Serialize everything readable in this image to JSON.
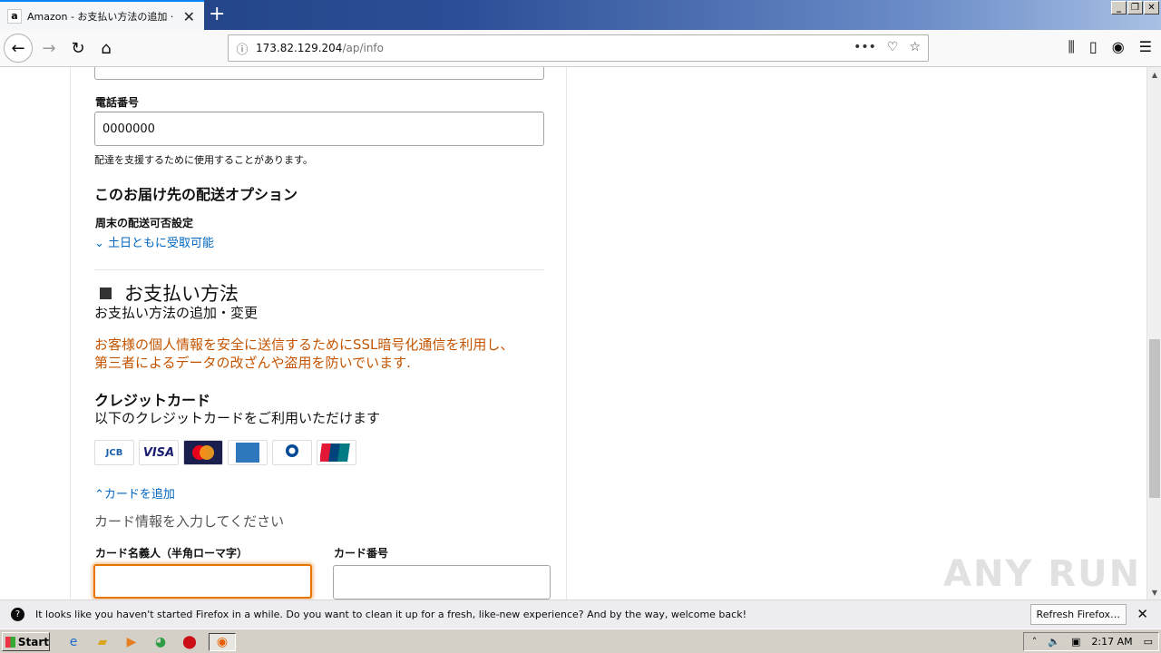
{
  "browser": {
    "tab_title": "Amazon - お支払い方法の追加 · S",
    "tab_favicon": "a",
    "url_host": "173.82.129.204",
    "url_path": "/ap/info",
    "new_tab": "+",
    "icons": {
      "back": "back-arrow-icon",
      "forward": "forward-arrow-icon",
      "reload": "reload-icon",
      "home": "home-icon",
      "info": "info-icon",
      "more": "ellipsis-icon",
      "pocket": "pocket-icon",
      "bookmark": "star-icon",
      "library": "library-icon",
      "sidebar": "sidebar-icon",
      "account": "account-icon",
      "menu": "hamburger-icon"
    }
  },
  "form": {
    "phone_label": "電話番号",
    "phone_value": "0000000",
    "phone_note": "配達を支援するために使用することがあります。",
    "delivery_options_heading": "このお届け先の配送オプション",
    "weekend_label": "周末の配送可否設定",
    "weekend_link": "土日ともに受取可能",
    "payment_heading": "お支払い方法",
    "payment_sub": "お支払い方法の追加・変更",
    "ssl_notice_line1": "お客様の個人情報を安全に送信するためにSSL暗号化通信を利用し、",
    "ssl_notice_line2": "第三者によるデータの改ざんや盗用を防いでいます.",
    "credit_heading": "クレジットカード",
    "credit_sub": "以下のクレジットカードをご利用いただけます",
    "cards": [
      "JCB",
      "VISA",
      "MasterCard",
      "AMEX",
      "Diners Club International",
      "UnionPay 银联"
    ],
    "add_card_link": "カードを追加",
    "card_info_prompt": "カード情報を入力してください",
    "cardholder_label": "カード名義人（半角ローマ字）",
    "card_number_label": "カード番号"
  },
  "notification": {
    "text": "It looks like you haven't started Firefox in a while. Do you want to clean it up for a fresh, like-new experience? And by the way, welcome back!",
    "button": "Refresh Firefox…"
  },
  "taskbar": {
    "start": "Start",
    "time": "2:17 AM"
  },
  "watermark": "ANY RUN"
}
